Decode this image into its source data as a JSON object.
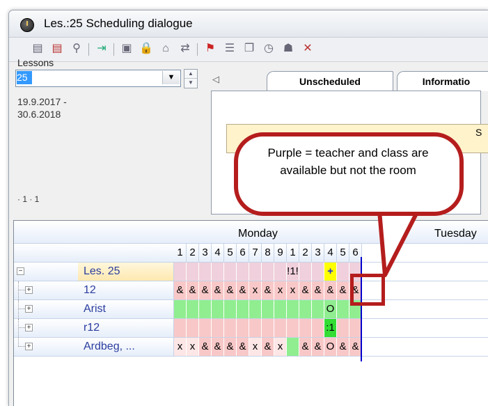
{
  "window": {
    "title": "Les.:25  Scheduling dialogue"
  },
  "left_panel": {
    "lessons_label": "Lessons",
    "lesson_value": "25",
    "date_range": "19.9.2017 -\n30.6.2018",
    "partial_label": "· 1 · 1"
  },
  "tabs": [
    {
      "label": "Unscheduled"
    },
    {
      "label": "Informatio"
    }
  ],
  "inner_header_letter": "S",
  "callout": {
    "text": "Purple = teacher and class are available but not the room"
  },
  "grid": {
    "days": [
      "Monday",
      "Tuesday"
    ],
    "periods": [
      "1",
      "2",
      "3",
      "4",
      "5",
      "6",
      "7",
      "8",
      "9",
      "1",
      "2",
      "3",
      "4",
      "5",
      "6"
    ],
    "rows": [
      {
        "name": "Les. 25",
        "type": "root",
        "cells": [
          "",
          "",
          "",
          "",
          "",
          "",
          "",
          "",
          "",
          "!1!",
          "",
          "",
          "+",
          "",
          ""
        ]
      },
      {
        "name": "12",
        "type": "child",
        "cells": [
          "&",
          "&",
          "&",
          "&",
          "&",
          "&",
          "x",
          "&",
          "x",
          "x",
          "&",
          "&",
          "&",
          "&",
          "&"
        ]
      },
      {
        "name": "Arist",
        "type": "child",
        "cells": [
          "",
          "",
          "",
          "",
          "",
          "",
          "",
          "",
          "",
          "",
          "",
          "",
          "O",
          "",
          ""
        ]
      },
      {
        "name": "r12",
        "type": "child",
        "cells": [
          "",
          "",
          "",
          "",
          "",
          "",
          "",
          "",
          "",
          "",
          "",
          "",
          ":1",
          "",
          ""
        ]
      },
      {
        "name": "Ardbeg, ...",
        "type": "child",
        "cells": [
          "x",
          "x",
          "&",
          "&",
          "&",
          "&",
          "x",
          "&",
          "x",
          "",
          "&",
          "&",
          "O",
          "&",
          "&"
        ]
      }
    ],
    "colors": {
      "pink": "#f8c8c8",
      "green": "#90ee90",
      "bright_green": "#33dd33",
      "yellow": "#ffff00",
      "lesson_row": "#f0d0dc",
      "light": "#fde6e6"
    }
  }
}
